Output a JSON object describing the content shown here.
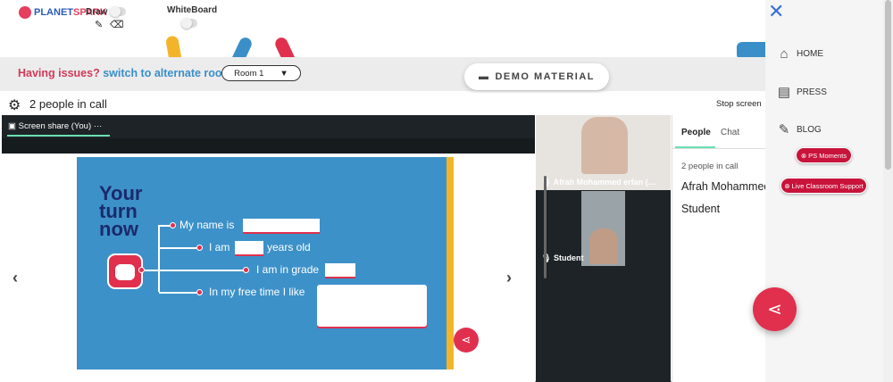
{
  "topbar": {
    "logo_text_a": "PLANET",
    "logo_text_b": "SPARK",
    "draw_label": "Draw",
    "whiteboard_label": "WhiteBoard"
  },
  "issues": {
    "prefix": "Having issues?",
    "link": "switch to alternate room",
    "room_value": "Room 1"
  },
  "demo_material_label": "DEMO MATERIAL",
  "call": {
    "people_in_call": "2 people in call",
    "stop_screen": "Stop screen",
    "share_tab": "Screen share (You)"
  },
  "slide": {
    "heading_1": "Your",
    "heading_2": "turn",
    "heading_3": "now",
    "line_1": "My name is",
    "line_2a": "I am",
    "line_2b": "years old",
    "line_3": "I am in grade",
    "line_4": "In my free time I like"
  },
  "videos": {
    "participant_1": "Afrah Mohammed erfan (…",
    "participant_2": "Student"
  },
  "people_panel": {
    "tab_people": "People",
    "tab_chat": "Chat",
    "count": "2 people in call",
    "name_1": "Afrah Mohammed",
    "name_2": "Student"
  },
  "sidenav": {
    "home": "HOME",
    "press": "PRESS",
    "blog": "BLOG",
    "ps_moments": "PS Moments",
    "live_support": "Live Classroom Support"
  },
  "colors": {
    "accent_red": "#e0304e",
    "link_blue": "#3a8fc8",
    "slide_blue": "#3d91c9",
    "teal_underline": "#6ae0b0"
  }
}
